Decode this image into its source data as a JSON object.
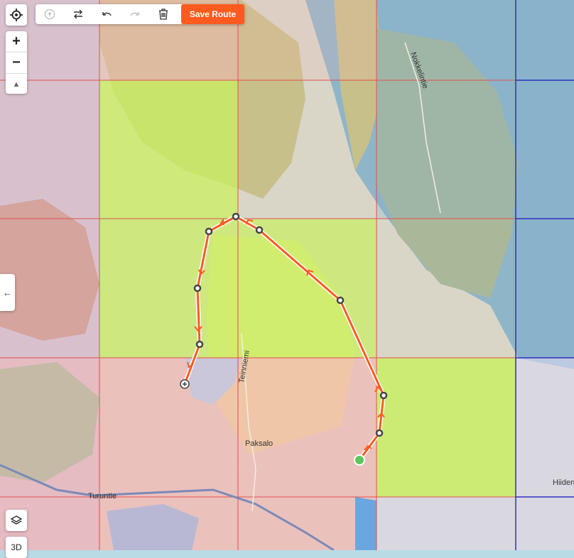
{
  "toolbar": {
    "save_label": "Save Route",
    "icons": [
      "help-icon",
      "reverse-icon",
      "undo-icon",
      "redo-icon",
      "trash-icon"
    ]
  },
  "controls": {
    "zoom_in": "+",
    "zoom_out": "−",
    "compass": "▲",
    "collapse": "←",
    "btn_3d": "3D"
  },
  "map": {
    "labels": {
      "paksalo": "Paksalo",
      "turuntie": "Turuntie",
      "teinniemi": "Teinniemi",
      "nokkelintie": "Nokkelintie",
      "hiiden": "Hiiden"
    },
    "colors": {
      "route": "#ff5a1f",
      "start": "#5ac85a",
      "grid_red": "#e05050",
      "grid_blue": "#3030c0"
    }
  }
}
